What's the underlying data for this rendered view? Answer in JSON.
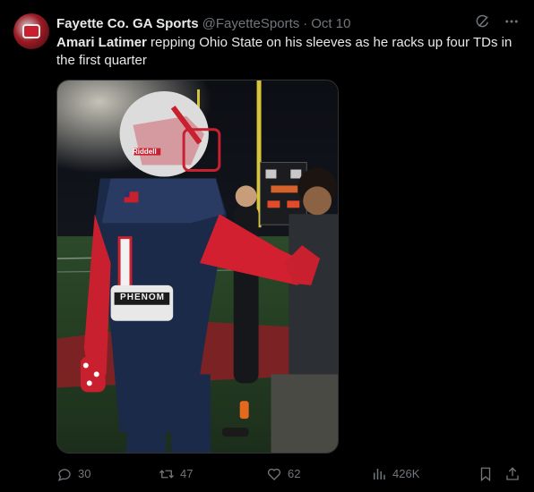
{
  "tweet": {
    "author": {
      "display_name": "Fayette Co. GA Sports",
      "handle": "@FayetteSports",
      "separator": "·",
      "date": "Oct 10"
    },
    "text": {
      "mention_name": "Amari Latimer",
      "body": " repping Ohio State on his sleeves as he racks up four TDs in the first quarter"
    },
    "media": {
      "jersey_number": "1",
      "sleeve_text": "PHENOM",
      "helmet_brand": "Riddell"
    },
    "actions": {
      "replies": "30",
      "retweets": "47",
      "likes": "62",
      "views": "426K"
    }
  },
  "colors": {
    "background": "#000000",
    "text_primary": "#e7e9ea",
    "text_secondary": "#71767b"
  }
}
